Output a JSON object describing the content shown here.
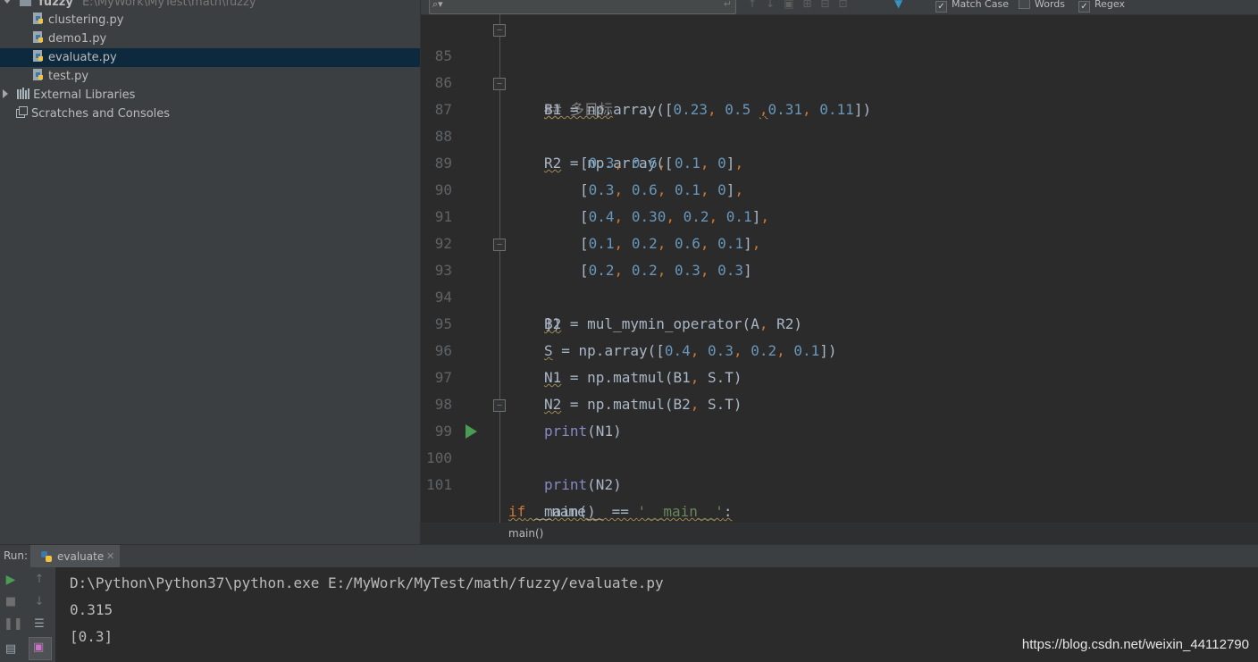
{
  "project": {
    "root_name": "fuzzy",
    "root_path": "E:\\MyWork\\MyTest\\math\\fuzzy",
    "files": [
      "clustering.py",
      "demo1.py",
      "evaluate.py",
      "test.py"
    ],
    "selected_file": "evaluate.py",
    "external_libraries": "External Libraries",
    "scratches": "Scratches and Consoles"
  },
  "find_bar": {
    "match_case": "Match Case",
    "words": "Words",
    "regex": "Regex",
    "match_case_checked": true,
    "words_checked": false,
    "regex_checked": true
  },
  "editor": {
    "line_numbers": [
      "85",
      "86",
      "87",
      "88",
      "89",
      "90",
      "91",
      "92",
      "93",
      "94",
      "95",
      "96",
      "97",
      "98",
      "99",
      "100",
      "101"
    ],
    "breadcrumb": "main()"
  },
  "run": {
    "label": "Run:",
    "tab_name": "evaluate",
    "console_lines": [
      "D:\\Python\\Python37\\python.exe E:/MyWork/MyTest/math/fuzzy/evaluate.py",
      "0.315",
      "[0.3]"
    ]
  },
  "watermark": "https://blog.csdn.net/weixin_44112790",
  "colors": {
    "keyword": "#cc7832",
    "number": "#6897bb",
    "builtin": "#8888c6",
    "string": "#6a8759",
    "comment": "#808080",
    "selection": "#0d293e",
    "run_green": "#499c54"
  }
}
